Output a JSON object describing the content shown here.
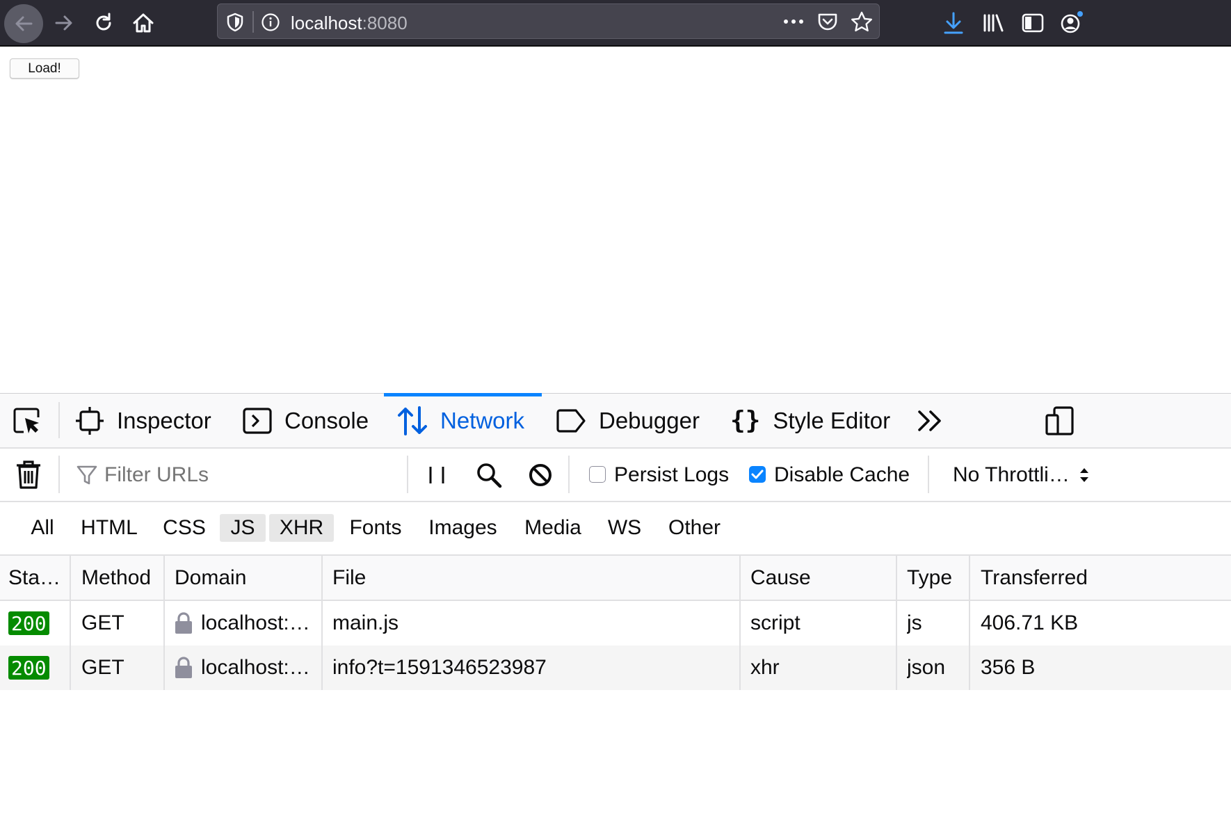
{
  "browser": {
    "url_host": "localhost",
    "url_port": ":8080"
  },
  "page": {
    "load_button": "Load!"
  },
  "devtools": {
    "tabs": [
      "Inspector",
      "Console",
      "Network",
      "Debugger",
      "Style Editor"
    ],
    "active_tab": "Network",
    "filter_placeholder": "Filter URLs",
    "persist_logs": {
      "label": "Persist Logs",
      "checked": false
    },
    "disable_cache": {
      "label": "Disable Cache",
      "checked": true
    },
    "throttling": "No Throttli…",
    "type_filters": [
      {
        "label": "All",
        "on": false
      },
      {
        "label": "HTML",
        "on": false
      },
      {
        "label": "CSS",
        "on": false
      },
      {
        "label": "JS",
        "on": true
      },
      {
        "label": "XHR",
        "on": true
      },
      {
        "label": "Fonts",
        "on": false
      },
      {
        "label": "Images",
        "on": false
      },
      {
        "label": "Media",
        "on": false
      },
      {
        "label": "WS",
        "on": false
      },
      {
        "label": "Other",
        "on": false
      }
    ],
    "columns": [
      "Sta…",
      "Method",
      "Domain",
      "File",
      "Cause",
      "Type",
      "Transferred"
    ],
    "rows": [
      {
        "status": "200",
        "method": "GET",
        "domain": "localhost:…",
        "file": "main.js",
        "cause": "script",
        "type": "js",
        "transferred": "406.71 KB"
      },
      {
        "status": "200",
        "method": "GET",
        "domain": "localhost:…",
        "file": "info?t=1591346523987",
        "cause": "xhr",
        "type": "json",
        "transferred": "356 B"
      }
    ]
  },
  "colors": {
    "accent": "#0a84ff",
    "active_tab_text": "#0060df",
    "status_ok": "#058b00"
  }
}
